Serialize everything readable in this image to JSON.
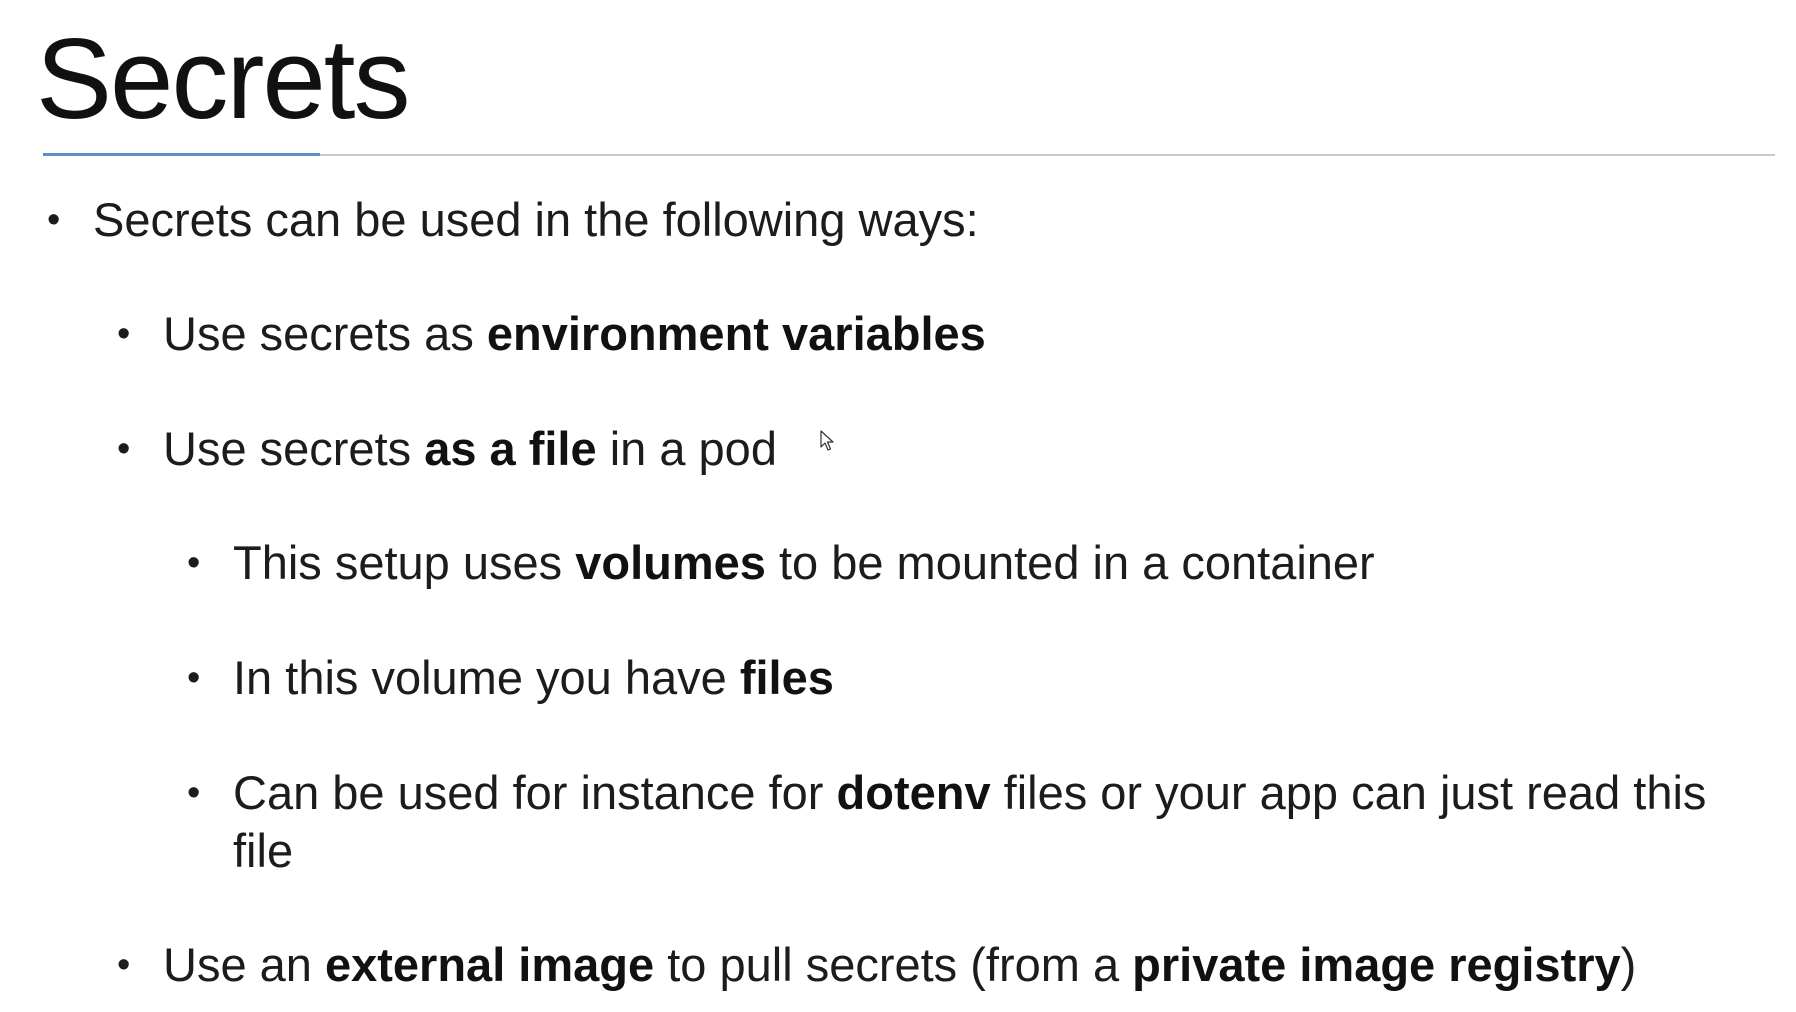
{
  "title": "Secrets",
  "bullets": {
    "b1": {
      "text": "Secrets can be used in the following ways:"
    },
    "b2": {
      "pre": "Use secrets as ",
      "bold": "environment variables"
    },
    "b3": {
      "pre": "Use secrets ",
      "bold": "as a file",
      "post": " in a pod"
    },
    "b4": {
      "pre": "This setup uses ",
      "bold": "volumes",
      "post": " to be mounted in a container"
    },
    "b5": {
      "pre": "In this volume you have ",
      "bold": "files"
    },
    "b6": {
      "pre": "Can be used for instance for ",
      "bold": "dotenv",
      "post": " files or your app can just read this file"
    },
    "b7": {
      "pre": "Use an ",
      "bold1": "external image",
      "mid": " to pull secrets (from a ",
      "bold2": "private image registry",
      "post": ")"
    }
  },
  "colors": {
    "accent_rule": "#5b8fc7",
    "text": "#1c1c1c"
  },
  "icons": {
    "cursor": "mouse-pointer-icon"
  }
}
